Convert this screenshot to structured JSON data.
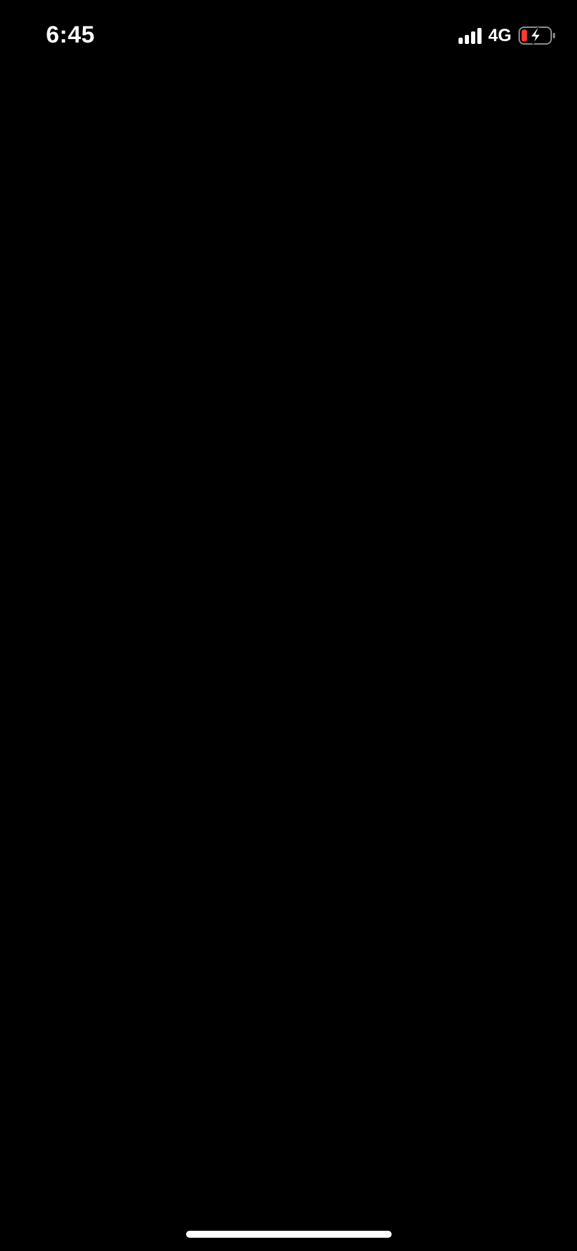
{
  "status_bar": {
    "time": "6:45",
    "network": "4G",
    "signal_icon": "cellular-signal-icon",
    "battery_icon": "battery-charging-icon",
    "battery_level": 0.2,
    "battery_charging": true,
    "battery_level_color": "#ff3b30"
  },
  "screen": {
    "background_color": "#000000"
  },
  "home_indicator": {
    "color": "#ffffff"
  }
}
